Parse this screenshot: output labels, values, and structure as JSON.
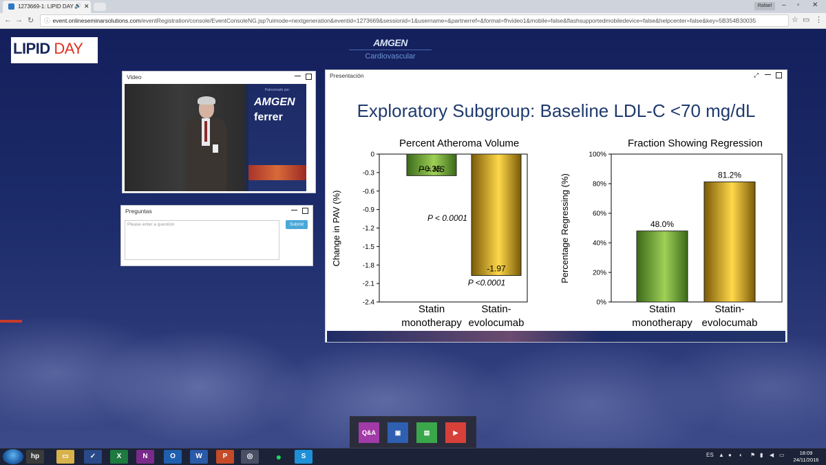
{
  "browser": {
    "tab_title": "1273669-1: LIPID DAY",
    "user_badge": "Rafael",
    "url_domain": "event.onlineseminarsolutions.com",
    "url_path": "/eventRegistration/console/EventConsoleNG.jsp?uimode=nextgeneration&eventid=1273669&sessionid=1&username=&partnerref=&format=fhvideo1&mobile=false&flashsupportedmobiledevice=false&helpcenter=false&key=5B354B30035"
  },
  "header": {
    "logo_main": "LIPID",
    "logo_accent": " DAY",
    "sponsor_name": "AMGEN",
    "sponsor_division": "Cardiovascular"
  },
  "video_panel": {
    "title": "Video",
    "banner_top": "Patrocinado por:",
    "banner_brand1": "AMGEN",
    "banner_brand2": "ferrer"
  },
  "questions_panel": {
    "title": "Preguntas",
    "placeholder": "Please enter a question",
    "submit_label": "Submit"
  },
  "presentation_panel": {
    "title": "Presentación",
    "slide_title": "Exploratory Subgroup: Baseline LDL-C <70 mg/dL"
  },
  "chart_data": [
    {
      "type": "bar",
      "title": "Percent Atheroma Volume",
      "ylabel": "Change in PAV (%)",
      "xlabel": "",
      "categories": [
        "Statin monotherapy",
        "Statin-evolocumab"
      ],
      "category_lines": [
        [
          "Statin",
          "monotherapy"
        ],
        [
          "Statin-",
          "evolocumab"
        ]
      ],
      "values": [
        -0.35,
        -1.97
      ],
      "value_labels": [
        "-0.35",
        "-1.97"
      ],
      "bar_colors": [
        "#6ea83a",
        "#f0c020"
      ],
      "ylim": [
        -2.4,
        0
      ],
      "yticks": [
        0,
        -0.3,
        -0.6,
        -0.9,
        -1.2,
        -1.5,
        -1.8,
        -2.1,
        -2.4
      ],
      "ytick_labels": [
        "0",
        "-0.3",
        "-0.6",
        "-0.9",
        "-1.2",
        "-1.5",
        "-1.8",
        "-2.1",
        "-2.4"
      ],
      "annotations": [
        "P = NS",
        "P < 0.0001",
        "P <0.0001"
      ]
    },
    {
      "type": "bar",
      "title": "Fraction Showing Regression",
      "ylabel": "Percentage Regressing (%)",
      "xlabel": "",
      "categories": [
        "Statin monotherapy",
        "Statin-evolocumab"
      ],
      "category_lines": [
        [
          "Statin",
          "monotherapy"
        ],
        [
          "Statin-",
          "evolocumab"
        ]
      ],
      "values": [
        48.0,
        81.2
      ],
      "value_labels": [
        "48.0%",
        "81.2%"
      ],
      "bar_colors": [
        "#6ea83a",
        "#f0c020"
      ],
      "ylim": [
        0,
        100
      ],
      "yticks": [
        0,
        20,
        40,
        60,
        80,
        100
      ],
      "ytick_labels": [
        "0%",
        "20%",
        "40%",
        "60%",
        "80%",
        "100%"
      ]
    }
  ],
  "dock": {
    "qa_label": "Q&A"
  },
  "taskbar": {
    "language": "ES",
    "time": "18:09",
    "date": "24/11/2016"
  },
  "colors": {
    "page_bg": "#1b2660",
    "slide_title": "#1f3a6d",
    "bar_green": "#6ea83a",
    "bar_gold": "#f0c020",
    "submit_button": "#4aa8d8"
  }
}
